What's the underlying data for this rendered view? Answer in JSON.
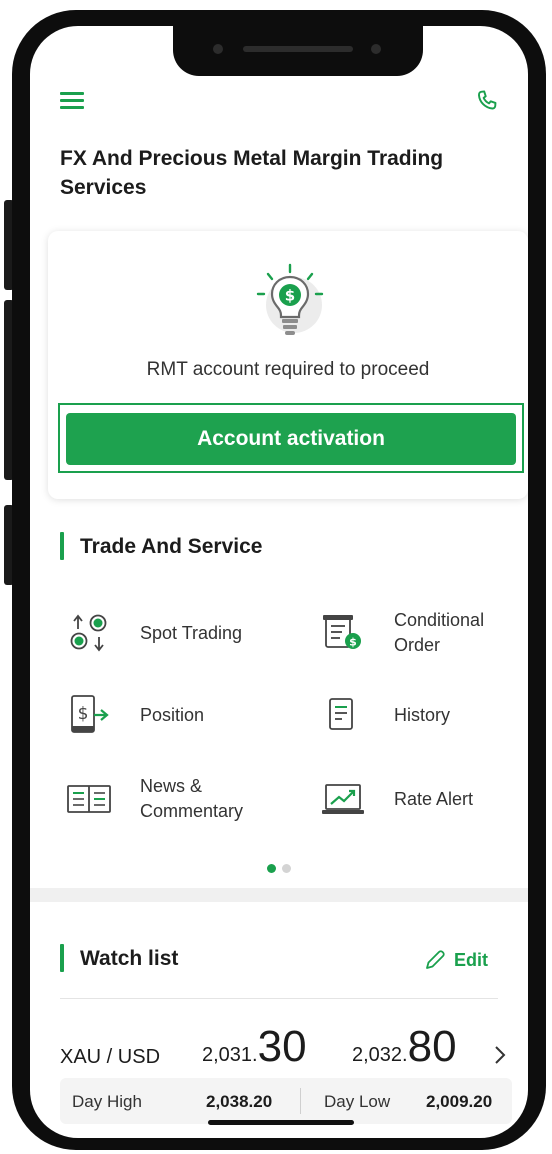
{
  "header": {
    "title": "FX And Precious Metal Margin Trading Services",
    "menu_icon": "hamburger-menu-icon",
    "phone_icon": "phone-icon"
  },
  "activation_card": {
    "icon": "lightbulb-dollar-icon",
    "message": "RMT account required to proceed",
    "button_label": "Account activation"
  },
  "trade_service": {
    "title": "Trade And Service",
    "items": [
      {
        "label": "Spot Trading",
        "icon": "currency-exchange-icon"
      },
      {
        "label": "Conditional Order",
        "icon": "conditional-order-icon"
      },
      {
        "label": "Position",
        "icon": "position-icon"
      },
      {
        "label": "History",
        "icon": "history-icon"
      },
      {
        "label": "News & Commentary",
        "icon": "news-icon"
      },
      {
        "label": "Rate Alert",
        "icon": "rate-alert-icon"
      }
    ],
    "pagination": {
      "pages": 2,
      "active": 1
    }
  },
  "watchlist": {
    "title": "Watch list",
    "edit_label": "Edit",
    "rows": [
      {
        "pair": "XAU / USD",
        "bid_prefix": "2,031.",
        "bid_suffix": "30",
        "ask_prefix": "2,032.",
        "ask_suffix": "80",
        "day_high_label": "Day High",
        "day_high": "2,038.20",
        "day_low_label": "Day Low",
        "day_low": "2,009.20"
      }
    ]
  },
  "colors": {
    "accent": "#1aa04d",
    "button": "#1ea24f",
    "text": "#1c1c1c"
  }
}
